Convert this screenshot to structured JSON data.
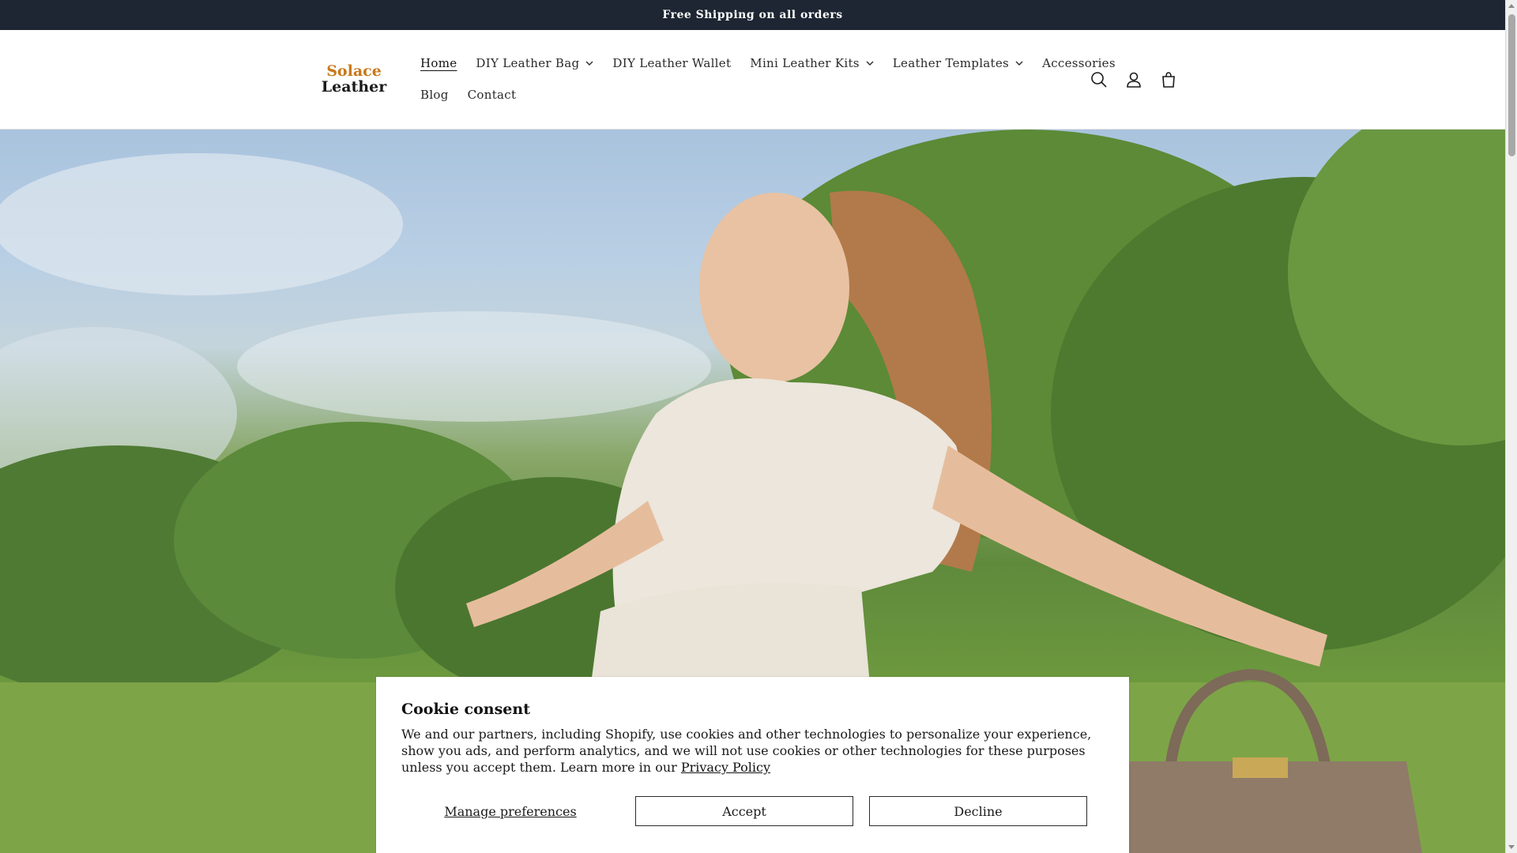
{
  "announcement": {
    "text": "Free Shipping on all orders"
  },
  "logo": {
    "line1": "Solace",
    "line2": "Leather"
  },
  "nav": {
    "items": [
      {
        "label": "Home",
        "dropdown": false,
        "active": true
      },
      {
        "label": "DIY Leather Bag",
        "dropdown": true,
        "active": false
      },
      {
        "label": "DIY Leather Wallet",
        "dropdown": false,
        "active": false
      },
      {
        "label": "Mini Leather Kits",
        "dropdown": true,
        "active": false
      },
      {
        "label": "Leather Templates",
        "dropdown": true,
        "active": false
      },
      {
        "label": "Accessories",
        "dropdown": false,
        "active": false
      },
      {
        "label": "Blog",
        "dropdown": false,
        "active": false
      },
      {
        "label": "Contact",
        "dropdown": false,
        "active": false
      }
    ]
  },
  "header_icons": [
    "search-icon",
    "account-icon",
    "cart-icon"
  ],
  "cookie": {
    "title": "Cookie consent",
    "body": "We and our partners, including Shopify, use cookies and other technologies to personalize your experience, show you ads, and perform analytics, and we will not use cookies or other technologies for these purposes unless you accept them. Learn more in our ",
    "link": "Privacy Policy",
    "manage_label": "Manage preferences",
    "accept_label": "Accept",
    "decline_label": "Decline"
  },
  "colors": {
    "announcement_bg": "#1e2633",
    "logo_accent": "#c8791b",
    "text": "#121212"
  }
}
